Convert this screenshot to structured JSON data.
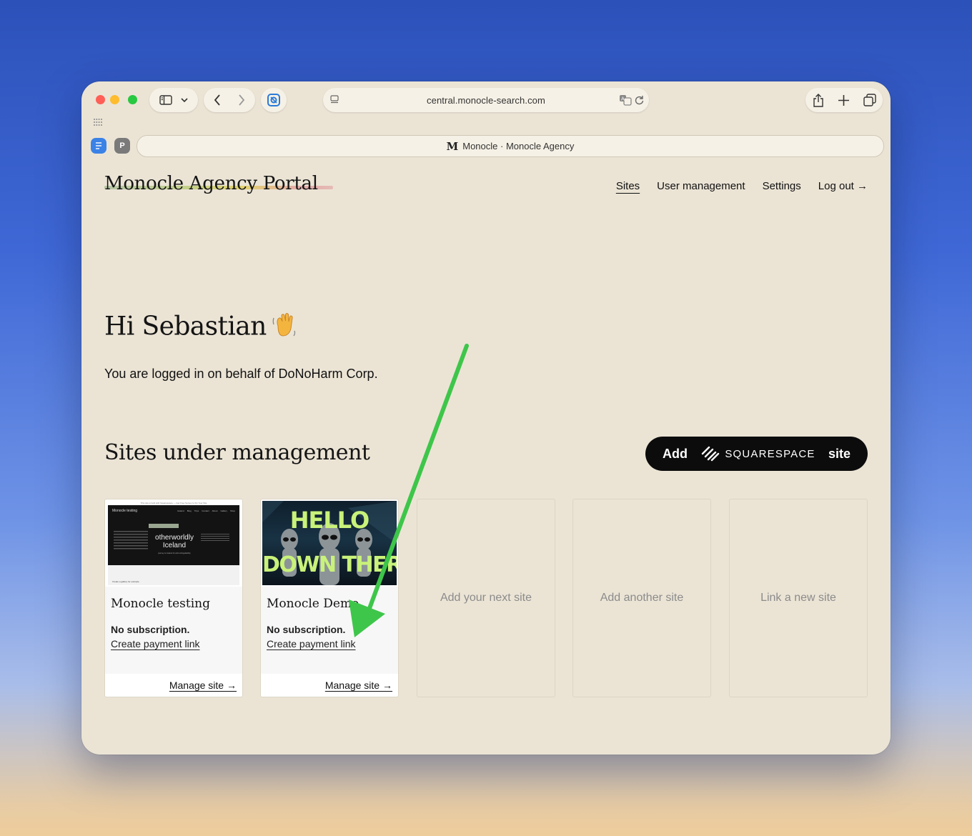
{
  "browser": {
    "url": "central.monocle-search.com",
    "tab_title": "Monocle · Monocle Agency",
    "tab_favicon": "M",
    "tabstrip_icon_2": "P"
  },
  "header": {
    "brand": "Monocle Agency Portal",
    "nav": [
      "Sites",
      "User management",
      "Settings",
      "Log out →"
    ]
  },
  "main": {
    "greeting": "Hi Sebastian",
    "greeting_emoji": "waving-hand-icon",
    "behalf_text": "You are logged in on behalf of DoNoHarm Corp.",
    "sites_heading": "Sites under management",
    "add_button": {
      "prefix": "Add",
      "brand": "SQUARESPACE",
      "suffix": "site"
    }
  },
  "sites": [
    {
      "title": "Monocle testing",
      "subscription": "No subscription.",
      "payment_link": "Create payment link",
      "manage": "Manage site →",
      "thumb": {
        "banner": "This site is built with Squarespace — Get Free Survey to Fix Your Site",
        "site_name": "Monocle testing",
        "menu": [
          "Iceland",
          "Blog",
          "Trips",
          "Contact",
          "About",
          "Gallery",
          "Shop"
        ],
        "headline": "otherworldly Iceland",
        "sub": "journey to Iceland for wild unforgettability",
        "footer": "Create a gallery for example"
      }
    },
    {
      "title": "Monocle Demo",
      "subscription": "No subscription.",
      "payment_link": "Create payment link",
      "manage": "Manage site →",
      "thumb": {
        "line1": "HELLO",
        "line2": "DOWN THERE"
      }
    }
  ],
  "placeholders": [
    "Add your next site",
    "Add another site",
    "Link a new site"
  ],
  "colors": {
    "page_bg": "#ebe4d5",
    "button_bg": "#0c0c0c",
    "annotation_arrow": "#3ec64a",
    "thumb_accent": "#c9f27a"
  }
}
